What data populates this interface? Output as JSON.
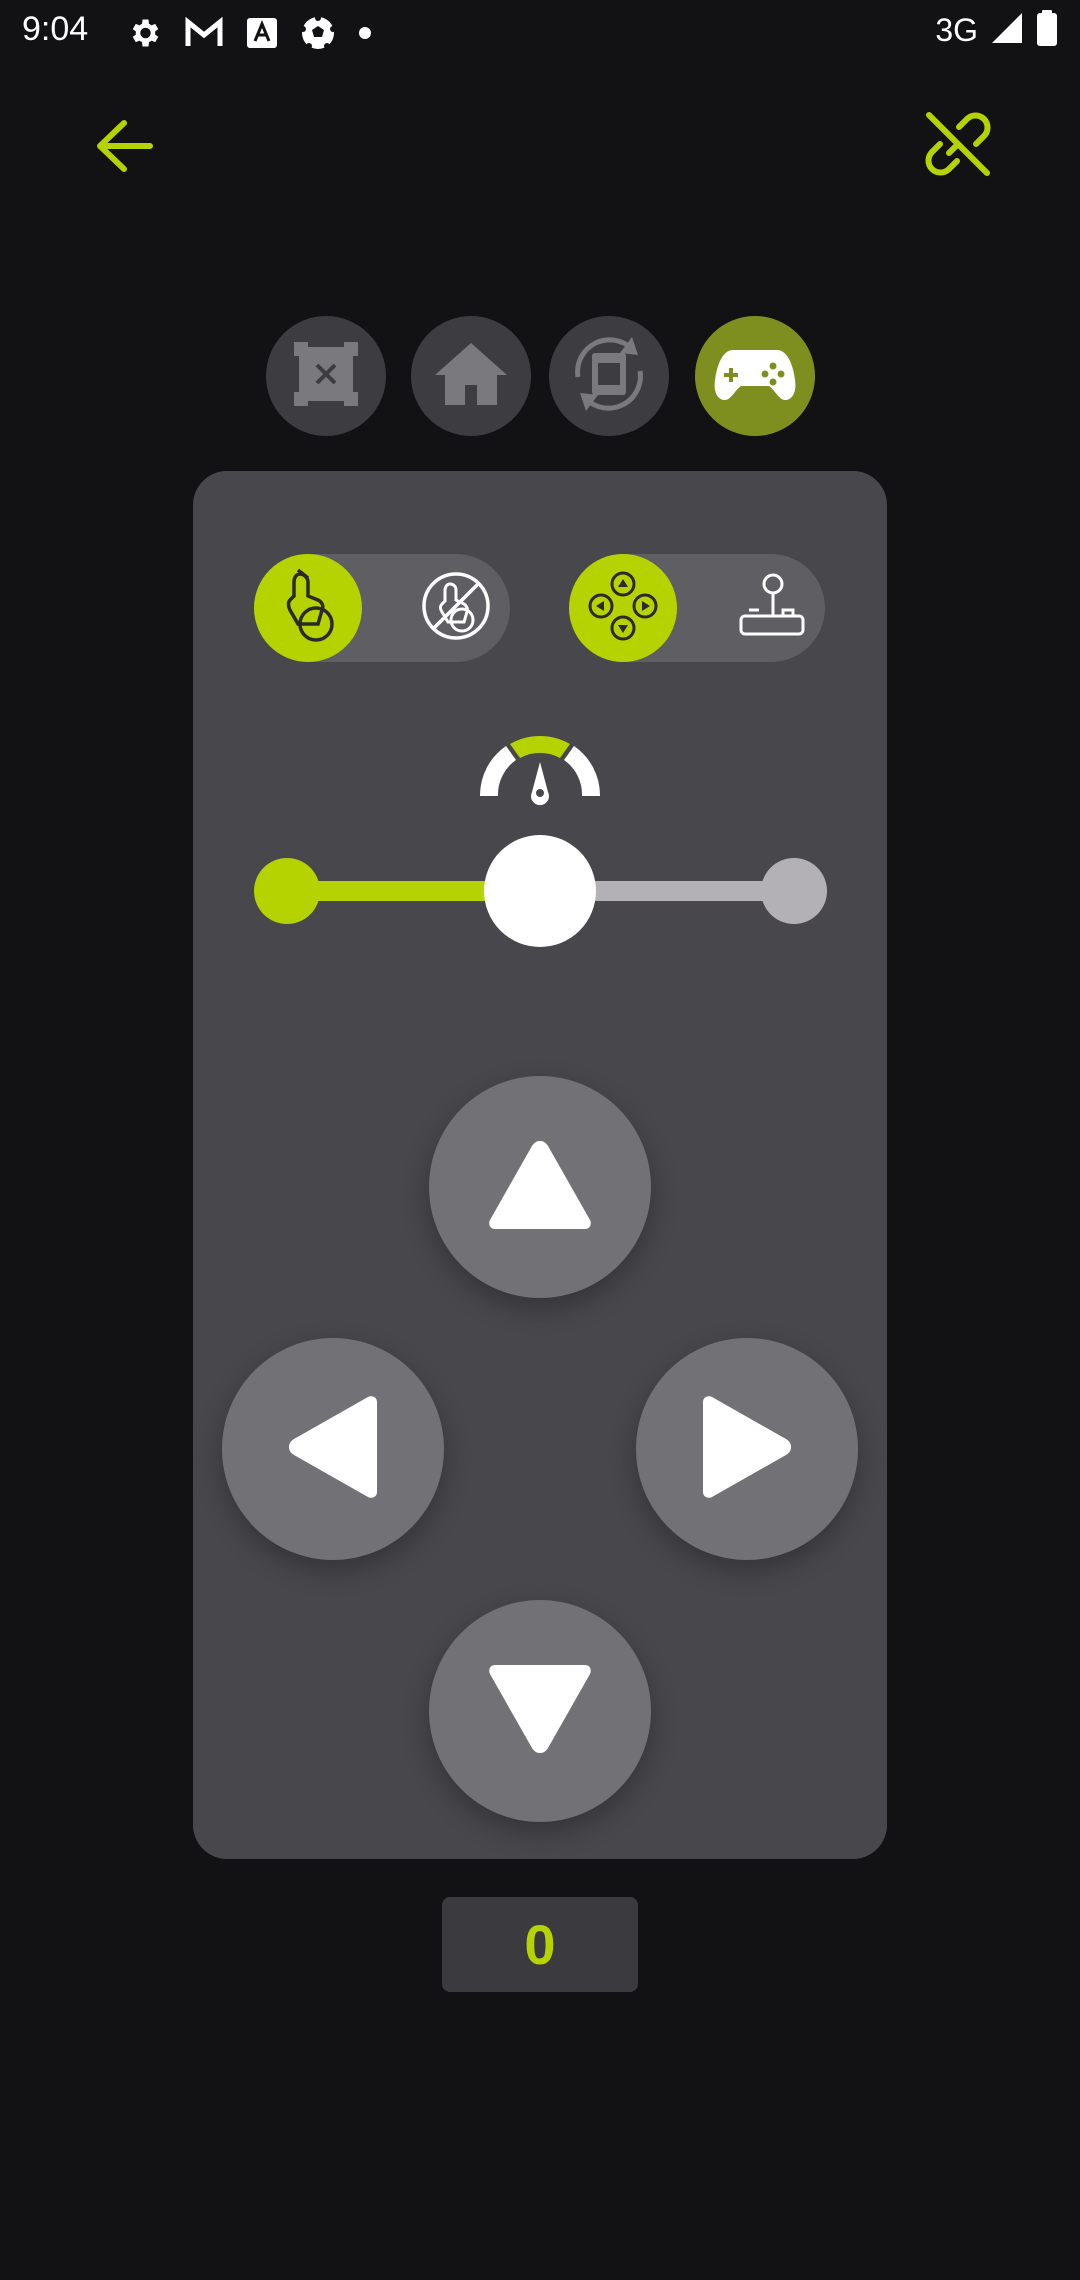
{
  "status_bar": {
    "time": "9:04",
    "network": "3G",
    "icons": [
      "settings-icon",
      "gmail-icon",
      "font-app-icon",
      "soccer-ball-icon",
      "notification-dot-icon",
      "signal-icon",
      "battery-icon"
    ]
  },
  "header": {
    "back_icon": "arrow-left-icon",
    "unlink_icon": "link-off-icon"
  },
  "modes": [
    {
      "id": "stop",
      "icon": "crop-x-icon",
      "active": false
    },
    {
      "id": "home",
      "icon": "home-icon",
      "active": false
    },
    {
      "id": "rotate",
      "icon": "rotate-device-icon",
      "active": false
    },
    {
      "id": "gamepad",
      "icon": "gamepad-icon",
      "active": true
    }
  ],
  "toggles": {
    "tilt": {
      "on_icon": "tilt-hand-icon",
      "off_icon": "tilt-disabled-icon",
      "selected": "on"
    },
    "control": {
      "on_icon": "dpad-icon",
      "off_icon": "joystick-icon",
      "selected": "on"
    }
  },
  "speed": {
    "icon": "speedometer-icon",
    "value": 0.5
  },
  "dpad": {
    "up_icon": "triangle-up-icon",
    "left_icon": "triangle-left-icon",
    "right_icon": "triangle-right-icon",
    "down_icon": "triangle-down-icon"
  },
  "counter": {
    "value": "0"
  },
  "colors": {
    "accent": "#b4d300",
    "background": "#121114",
    "panel": "#48474b",
    "button": "#727175",
    "active_mode": "#7f8f1f"
  }
}
